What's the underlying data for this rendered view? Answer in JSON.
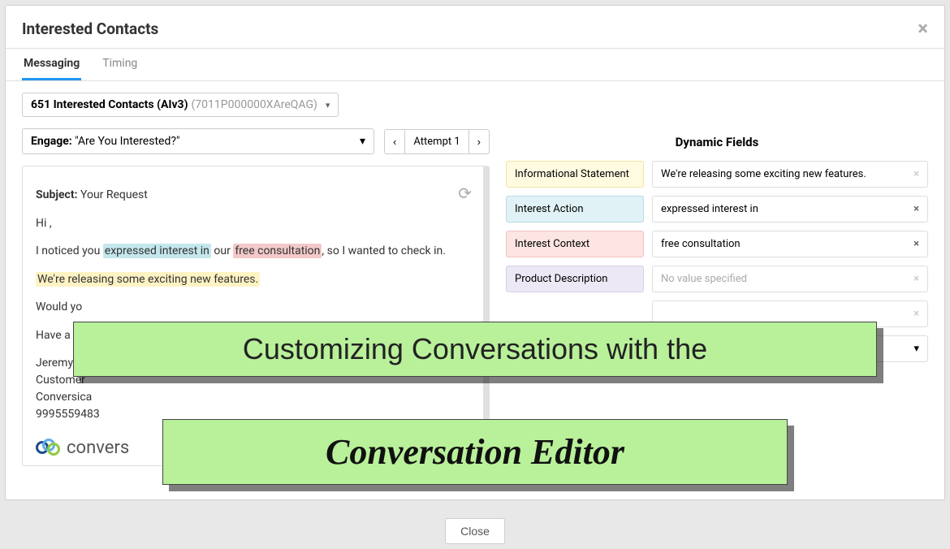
{
  "header": {
    "title": "Interested Contacts"
  },
  "tabs": {
    "messaging": "Messaging",
    "timing": "Timing"
  },
  "campaign": {
    "label": "651 Interested Contacts (AIv3)",
    "id": "(7011P000000XAreQAG)"
  },
  "engage": {
    "label": "Engage:",
    "value": "\"Are You Interested?\""
  },
  "attempt": {
    "prev": "‹",
    "label": "Attempt 1",
    "next": "›"
  },
  "email": {
    "subject_label": "Subject:",
    "subject": "Your Request",
    "greeting": "Hi ,",
    "line1_a": "I noticed you ",
    "line1_action": "expressed interest in",
    "line1_b": " our ",
    "line1_context": "free consultation",
    "line1_c": ", so I wanted to check in.",
    "line2": "We're releasing some exciting new features.",
    "line3": "Would yo",
    "line4": "Have a g",
    "sig_name": "Jeremy J",
    "sig_title": "Customer",
    "sig_company": "Conversica",
    "sig_phone": "9995559483",
    "logo_text": "convers"
  },
  "dynamic": {
    "heading": "Dynamic Fields",
    "rows": [
      {
        "tag": "Informational Statement",
        "value": "We're releasing some exciting new features.",
        "tagClass": "tag-yellow",
        "placeholder": false,
        "faded": true
      },
      {
        "tag": "Interest Action",
        "value": "expressed interest in",
        "tagClass": "tag-blue",
        "placeholder": false,
        "faded": false
      },
      {
        "tag": "Interest Context",
        "value": "free consultation",
        "tagClass": "tag-red",
        "placeholder": false,
        "faded": false
      },
      {
        "tag": "Product Description",
        "value": "No value specified",
        "tagClass": "tag-purple",
        "placeholder": true,
        "faded": true
      }
    ]
  },
  "footer": {
    "close": "Close"
  },
  "overlay": {
    "line1": "Customizing Conversations with the",
    "line2": "Conversation Editor"
  }
}
